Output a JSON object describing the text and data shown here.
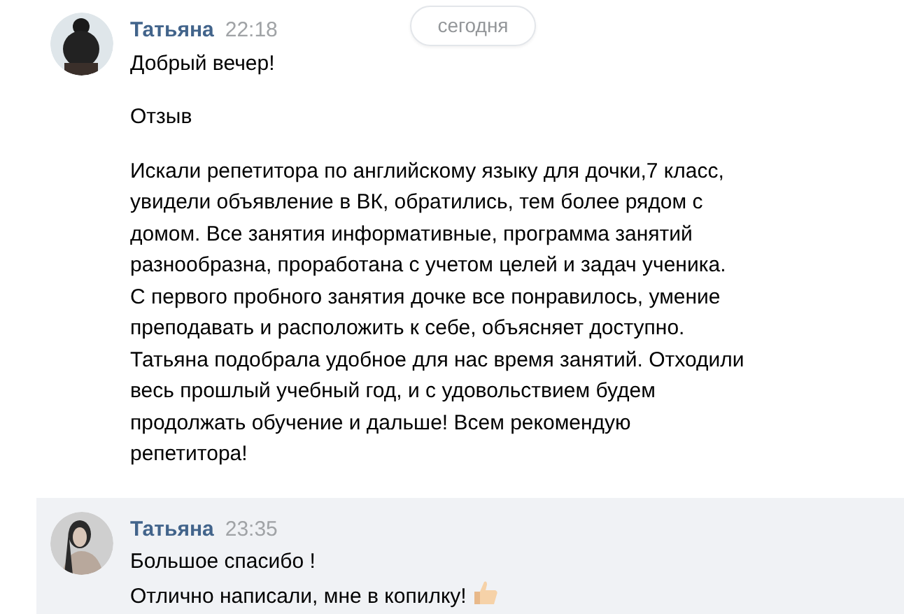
{
  "date_divider": "сегодня",
  "messages": [
    {
      "author": "Татьяна",
      "time": "22:18",
      "highlighted": false,
      "paragraphs": [
        [
          "Добрый вечер!"
        ],
        [
          "Отзыв"
        ],
        [
          "Искали репетитора по английскому языку для дочки,7 класс,",
          "увидели объявление в ВК, обратились, тем более рядом с",
          "домом. Все занятия информативные, программа занятий",
          "разнообразна, проработана с учетом целей и задач ученика.",
          "С первого пробного занятия дочке все понравилось, умение",
          "преподавать и расположить к себе, объясняет доступно.",
          "Татьяна подобрала удобное для нас время занятий. Отходили",
          "весь прошлый учебный год, и с удовольствием будем",
          "продолжать обучение и дальше! Всем рекомендую",
          "репетитора!"
        ]
      ],
      "thumbs_up": false
    },
    {
      "author": "Татьяна",
      "time": "23:35",
      "highlighted": true,
      "paragraphs": [
        [
          "Большое спасибо !",
          "Отлично написали, мне в копилку!"
        ]
      ],
      "thumbs_up": true
    }
  ]
}
